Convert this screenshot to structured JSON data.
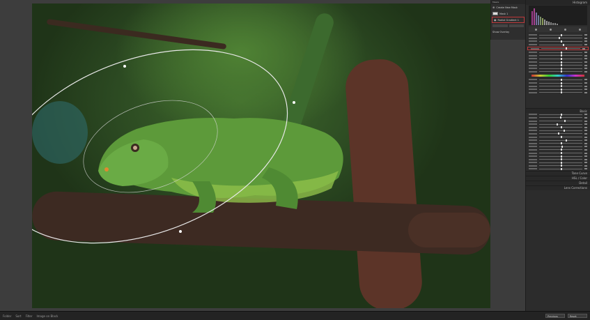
{
  "masks_panel": {
    "header": "Masks",
    "items": [
      {
        "label": "Create New Mask"
      },
      {
        "label": "Mask 1"
      },
      {
        "label": "Radial Gradient 1"
      }
    ],
    "footer": "Show Overlay"
  },
  "right_panel": {
    "histogram_label": "Histogram",
    "sections": [
      {
        "label": "Basic"
      },
      {
        "label": "Tone Curve"
      },
      {
        "label": "HSL / Color"
      },
      {
        "label": "Detail"
      },
      {
        "label": "Lens Corrections"
      }
    ],
    "bottom_buttons": [
      "Previous",
      "Reset"
    ]
  },
  "bottom_bar": {
    "items": [
      "Folder",
      "Sort",
      "Filter",
      "Image on Black"
    ]
  },
  "colors": {
    "mask_highlight": "#c0393b",
    "panel_bg": "#2c2c2c"
  }
}
